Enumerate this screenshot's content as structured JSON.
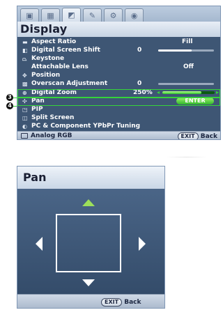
{
  "display_menu": {
    "tabs": [
      {
        "icon": "picture-icon"
      },
      {
        "icon": "picture-advanced-icon"
      },
      {
        "icon": "display-icon",
        "active": true
      },
      {
        "icon": "tools-icon"
      },
      {
        "icon": "settings-icon"
      },
      {
        "icon": "info-icon"
      }
    ],
    "title": "Display",
    "items": [
      {
        "label": "Aspect Ratio",
        "value": "Fill",
        "icon": "aspect-ratio-icon"
      },
      {
        "label": "Digital Screen Shift",
        "value": "0",
        "slider": 0.6,
        "icon": "screen-shift-icon"
      },
      {
        "label": "Keystone",
        "value": "",
        "icon": "keystone-icon"
      },
      {
        "label": "Attachable Lens",
        "value": "Off",
        "icon": ""
      },
      {
        "label": "Position",
        "value": "",
        "icon": "position-icon"
      },
      {
        "label": "Overscan Adjustment",
        "value": "0",
        "slider": 0.0,
        "icon": "overscan-icon"
      },
      {
        "label": "Digital Zoom",
        "value": "250%",
        "slider": 0.75,
        "icon": "zoom-icon"
      },
      {
        "label": "Pan",
        "value": "ENTER",
        "icon": "pan-icon"
      },
      {
        "label": "PIP",
        "value": "",
        "icon": "pip-icon"
      },
      {
        "label": "Split Screen",
        "value": "",
        "icon": "split-screen-icon"
      },
      {
        "label": "PC & Component YPbPr Tuning",
        "value": "",
        "icon": "tuning-icon"
      }
    ],
    "status": {
      "source_icon": "input-source-icon",
      "source": "Analog RGB",
      "exit_label": "EXIT",
      "back_label": "Back"
    }
  },
  "callouts": {
    "zoom": "3",
    "pan": "4"
  },
  "pan_dialog": {
    "title": "Pan",
    "exit_label": "EXIT",
    "back_label": "Back"
  },
  "colors": {
    "highlight": "#35d43a",
    "enter_pill": "#2fb62d",
    "menu_bg": "#3e5674"
  }
}
